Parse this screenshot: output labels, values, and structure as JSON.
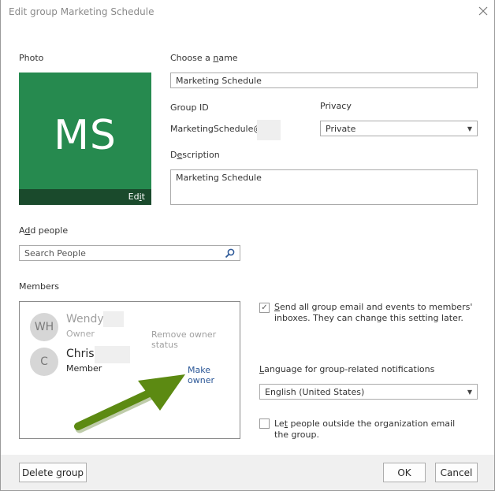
{
  "dialog": {
    "title": "Edit group Marketing Schedule",
    "close_icon": "close-x-icon"
  },
  "photo": {
    "label": "Photo",
    "initials": "MS",
    "edit_label_pre": "Ed",
    "edit_label_ul": "i",
    "edit_label_post": "t",
    "tile_color": "#268a4f"
  },
  "name": {
    "label_pre": "Choose a ",
    "label_ul": "n",
    "label_post": "ame",
    "value": "Marketing Schedule"
  },
  "group_id": {
    "label": "Group ID",
    "value": "MarketingSchedule@"
  },
  "privacy": {
    "label": "Privacy",
    "value": "Private"
  },
  "description": {
    "label_pre": "D",
    "label_ul": "e",
    "label_post": "scription",
    "value": "Marketing Schedule"
  },
  "add_people": {
    "label_pre": "A",
    "label_ul": "d",
    "label_post": "d people",
    "placeholder": "Search People",
    "search_icon": "magnifier-icon"
  },
  "members": {
    "label": "Members",
    "items": [
      {
        "initials": "WH",
        "name": "Wendy",
        "role": "Owner",
        "action": "Remove owner status"
      },
      {
        "initials": "C",
        "name": "Chris",
        "role": "Member",
        "action": "Make owner"
      }
    ]
  },
  "send_email": {
    "checked": true,
    "label_ul": "S",
    "label_rest": "end all group email and events to members' inboxes. They can change this setting later."
  },
  "language": {
    "label_ul": "L",
    "label_rest": "anguage for group-related notifications",
    "value": "English (United States)"
  },
  "outside_email": {
    "checked": false,
    "label_pre": "Le",
    "label_ul": "t",
    "label_post": " people outside the organization email the group."
  },
  "footer": {
    "delete_pre": "Delete ",
    "delete_ul": "g",
    "delete_post": "roup",
    "ok": "OK",
    "cancel": "Cancel"
  },
  "annotation": {
    "arrow_color": "#5c8a12",
    "points_to": "Make owner"
  }
}
